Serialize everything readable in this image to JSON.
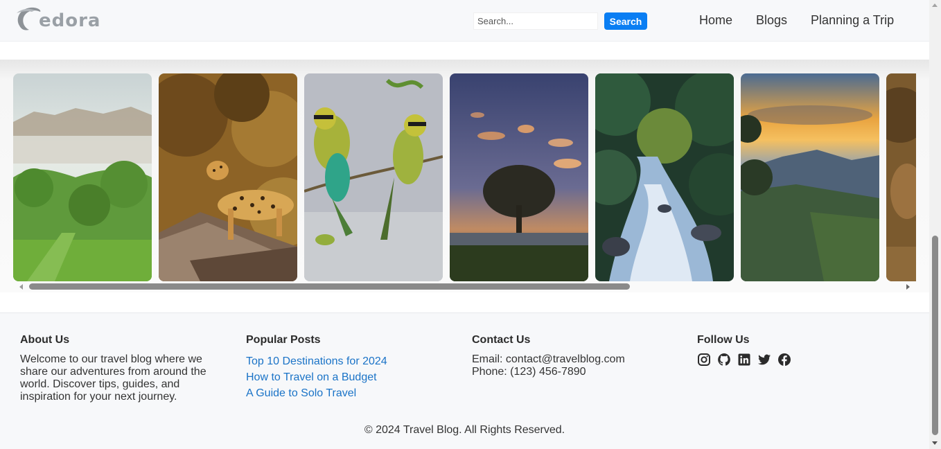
{
  "header": {
    "logo_text": "edora",
    "search": {
      "placeholder": "Search...",
      "button_label": "Search"
    },
    "nav": [
      {
        "label": "Home"
      },
      {
        "label": "Blogs"
      },
      {
        "label": "Planning a Trip"
      }
    ]
  },
  "gallery": {
    "images": [
      {
        "subject": "misty-rock-fortress-forest"
      },
      {
        "subject": "leopard-on-rock"
      },
      {
        "subject": "bee-eater-birds"
      },
      {
        "subject": "lone-tree-at-dusk"
      },
      {
        "subject": "jungle-river-rapids"
      },
      {
        "subject": "mountain-sunset"
      },
      {
        "subject": "deer-partial"
      }
    ]
  },
  "footer": {
    "about": {
      "heading": "About Us",
      "text": "Welcome to our travel blog where we share our adventures from around the world. Discover tips, guides, and inspiration for your next journey."
    },
    "popular": {
      "heading": "Popular Posts",
      "links": [
        {
          "label": "Top 10 Destinations for 2024"
        },
        {
          "label": "How to Travel on a Budget"
        },
        {
          "label": "A Guide to Solo Travel"
        }
      ]
    },
    "contact": {
      "heading": "Contact Us",
      "email": "Email: contact@travelblog.com",
      "phone": "Phone: (123) 456-7890"
    },
    "follow": {
      "heading": "Follow Us",
      "icons": [
        "instagram-icon",
        "github-icon",
        "linkedin-icon",
        "twitter-icon",
        "facebook-icon"
      ]
    },
    "copyright": "© 2024 Travel Blog. All Rights Reserved."
  },
  "colors": {
    "accent": "#0a7ef3",
    "link": "#1a73c7",
    "header_bg": "#f7f8fa",
    "footer_bg": "#f7f8fa"
  }
}
